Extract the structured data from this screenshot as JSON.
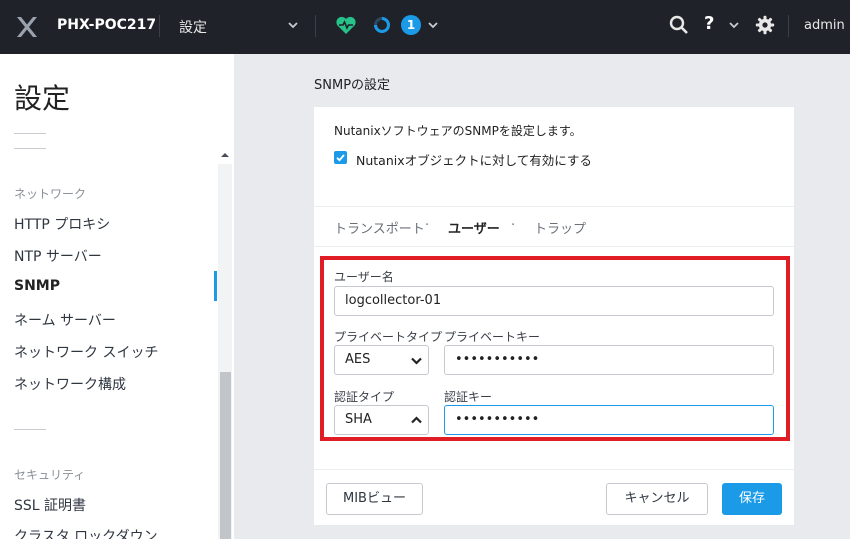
{
  "topbar": {
    "cluster_name": "PHX-POC217",
    "menu_title": "設定",
    "alert_count": "1",
    "help_label": "?",
    "user": "admin"
  },
  "sidebar": {
    "title": "設定",
    "sections": [
      {
        "label": "ネットワーク",
        "items": [
          "HTTP プロキシ",
          "NTP サーバー",
          "SNMP",
          "ネーム サーバー",
          "ネットワーク スイッチ",
          "ネットワーク構成"
        ]
      },
      {
        "label": "セキュリティ",
        "items": [
          "SSL 証明書",
          "クラスタ ロックダウン"
        ]
      }
    ],
    "active_item": "SNMP"
  },
  "main": {
    "title": "SNMPの設定",
    "description": "NutanixソフトウェアのSNMPを設定します。",
    "checkbox": {
      "label": "Nutanixオブジェクトに対して有効にする",
      "checked": true
    },
    "tabs": [
      "トランスポート",
      "ユーザー",
      "トラップ"
    ],
    "active_tab": "ユーザー",
    "tab_separator": "·",
    "form": {
      "username_label": "ユーザー名",
      "username_value": "logcollector-01",
      "priv_type_label": "プライベートタイプ",
      "priv_type_value": "AES",
      "priv_key_label": "プライベートキー",
      "priv_key_value": "•••••••••••",
      "auth_type_label": "認証タイプ",
      "auth_type_value": "SHA",
      "auth_key_label": "認証キー",
      "auth_key_value": "•••••••••••"
    },
    "buttons": {
      "mib": "MIBビュー",
      "cancel": "キャンセル",
      "save": "保存"
    }
  },
  "colors": {
    "accent": "#1b9ae8",
    "highlight": "#e01c24",
    "topbar": "#1f2228",
    "health": "#27c28a"
  }
}
